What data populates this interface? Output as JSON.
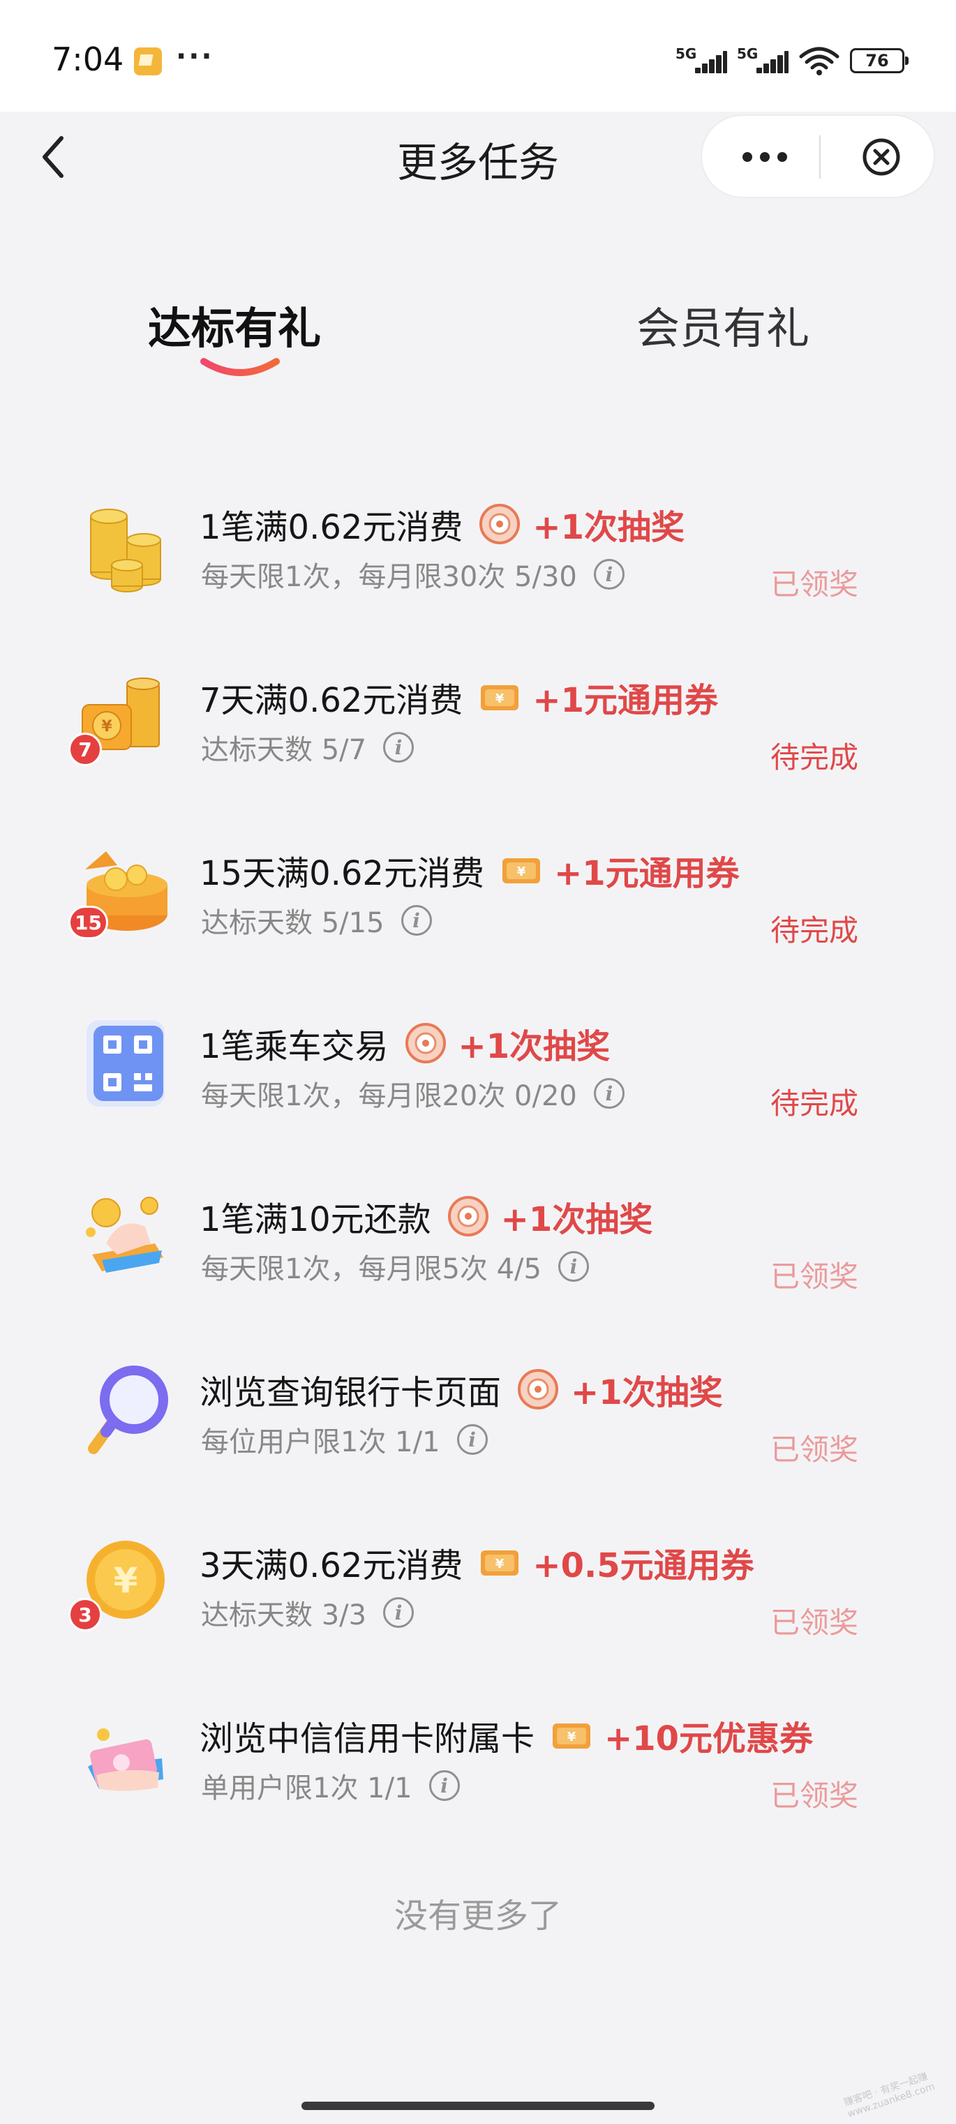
{
  "status_bar": {
    "time": "7:04",
    "dots": "···",
    "signal_1": "5G",
    "signal_2": "5G",
    "battery": "76"
  },
  "nav": {
    "title": "更多任务",
    "back_icon": "chevron-left-icon",
    "more_icon": "more-dots-icon",
    "close_icon": "close-circle-icon"
  },
  "tabs": [
    {
      "label": "达标有礼",
      "active": true
    },
    {
      "label": "会员有礼",
      "active": false
    }
  ],
  "tasks": [
    {
      "icon": "coin-stack-icon",
      "title": "1笔满0.62元消费",
      "reward_icon": "lottery-disc-icon",
      "reward": "+1次抽奖",
      "sub": "每天限1次，每月限30次 5/30",
      "status": "已领奖",
      "status_type": "done"
    },
    {
      "icon": "coin-stack-gold-icon",
      "badge": "7",
      "title": "7天满0.62元消费",
      "reward_icon": "coupon-icon",
      "reward": "+1元通用券",
      "sub": "达标天数 5/7",
      "status": "待完成",
      "status_type": "pending"
    },
    {
      "icon": "treasure-box-icon",
      "badge": "15",
      "title": "15天满0.62元消费",
      "reward_icon": "coupon-icon",
      "reward": "+1元通用券",
      "sub": "达标天数 5/15",
      "status": "待完成",
      "status_type": "pending"
    },
    {
      "icon": "qr-code-icon",
      "title": "1笔乘车交易",
      "reward_icon": "lottery-disc-icon",
      "reward": "+1次抽奖",
      "sub": "每天限1次，每月限20次 0/20",
      "status": "待完成",
      "status_type": "pending"
    },
    {
      "icon": "hand-coin-icon",
      "title": "1笔满10元还款",
      "reward_icon": "lottery-disc-icon",
      "reward": "+1次抽奖",
      "sub": "每天限1次，每月限5次 4/5",
      "status": "已领奖",
      "status_type": "done"
    },
    {
      "icon": "magnifier-icon",
      "title": "浏览查询银行卡页面",
      "reward_icon": "lottery-disc-icon",
      "reward": "+1次抽奖",
      "sub": "每位用户限1次 1/1",
      "status": "已领奖",
      "status_type": "done"
    },
    {
      "icon": "yuan-coin-icon",
      "badge": "3",
      "title": "3天满0.62元消费",
      "reward_icon": "coupon-icon",
      "reward": "+0.5元通用券",
      "sub": "达标天数 3/3",
      "status": "已领奖",
      "status_type": "done"
    },
    {
      "icon": "hand-card-icon",
      "title": "浏览中信信用卡附属卡",
      "reward_icon": "coupon-icon",
      "reward": "+10元优惠券",
      "sub": "单用户限1次 1/1",
      "status": "已领奖",
      "status_type": "done"
    }
  ],
  "footer": {
    "end_text": "没有更多了",
    "watermark": "赚客吧 · 有奖一起赚 www.zuanke8.com"
  },
  "colors": {
    "accent_red": "#e04848",
    "done_pink": "#eb9a9a",
    "page_bg": "#f3f3f6"
  }
}
